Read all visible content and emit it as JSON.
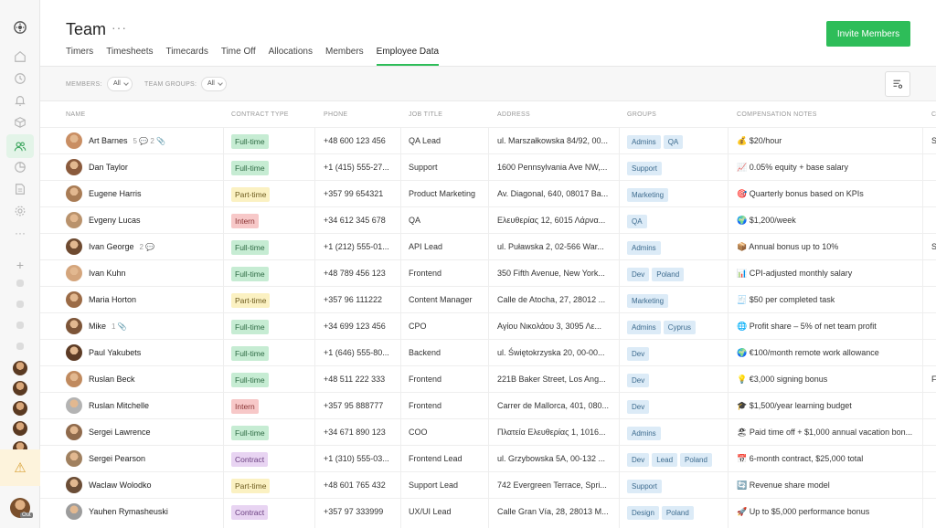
{
  "header": {
    "title": "Team",
    "more": "···",
    "invite_label": "Invite Members",
    "tabs": [
      "Timers",
      "Timesheets",
      "Timecards",
      "Time Off",
      "Allocations",
      "Members",
      "Employee Data"
    ],
    "active_tab": "Employee Data"
  },
  "filters": {
    "members_label": "MEMBERS:",
    "members_value": "All",
    "groups_label": "TEAM GROUPS:",
    "groups_value": "All"
  },
  "columns": [
    "NAME",
    "CONTRACT TYPE",
    "PHONE",
    "JOB TITLE",
    "ADDRESS",
    "GROUPS",
    "COMPENSATION NOTES",
    "C"
  ],
  "colors": {
    "accent": "#2ebd59",
    "full_time": "#c6ecd3",
    "part_time": "#fbf1c2",
    "intern": "#f7c8c8",
    "contract": "#e8d4f2",
    "group_badge": "#dcebf7"
  },
  "rows": [
    {
      "name": "Art Barnes",
      "meta": "5 💬  2 📎",
      "contract": "Full-time",
      "phone": "+48 600 123 456",
      "job": "QA Lead",
      "address": "ul. Marszałkowska 84/92, 00...",
      "groups": [
        "Admins",
        "QA"
      ],
      "comp": "💰 $20/hour",
      "extra": "S"
    },
    {
      "name": "Dan Taylor",
      "meta": "",
      "contract": "Full-time",
      "phone": "+1 (415) 555-27...",
      "job": "Support",
      "address": "1600 Pennsylvania Ave NW,...",
      "groups": [
        "Support"
      ],
      "comp": "📈 0.05% equity + base salary",
      "extra": ""
    },
    {
      "name": "Eugene Harris",
      "meta": "",
      "contract": "Part-time",
      "phone": "+357 99 654321",
      "job": "Product Marketing",
      "address": "Av. Diagonal, 640, 08017 Ba...",
      "groups": [
        "Marketing"
      ],
      "comp": "🎯 Quarterly bonus based on KPIs",
      "extra": ""
    },
    {
      "name": "Evgeny Lucas",
      "meta": "",
      "contract": "Intern",
      "phone": "+34 612 345 678",
      "job": "QA",
      "address": "Ελευθερίας 12, 6015 Λάρνα...",
      "groups": [
        "QA"
      ],
      "comp": "🌍 $1,200/week",
      "extra": ""
    },
    {
      "name": "Ivan George",
      "meta": "2 💬",
      "contract": "Full-time",
      "phone": "+1 (212) 555-01...",
      "job": "API Lead",
      "address": "ul. Puławska 2, 02-566 War...",
      "groups": [
        "Admins"
      ],
      "comp": "📦 Annual bonus up to 10%",
      "extra": "S"
    },
    {
      "name": "Ivan Kuhn",
      "meta": "",
      "contract": "Full-time",
      "phone": "+48 789 456 123",
      "job": "Frontend",
      "address": "350 Fifth Avenue, New York...",
      "groups": [
        "Dev",
        "Poland"
      ],
      "comp": "📊 CPI-adjusted monthly salary",
      "extra": ""
    },
    {
      "name": "Maria Horton",
      "meta": "",
      "contract": "Part-time",
      "phone": "+357 96 111222",
      "job": "Content Manager",
      "address": "Calle de Atocha, 27, 28012 ...",
      "groups": [
        "Marketing"
      ],
      "comp": "🧾 $50 per completed task",
      "extra": ""
    },
    {
      "name": "Mike",
      "meta": "1 📎",
      "contract": "Full-time",
      "phone": "+34 699 123 456",
      "job": "CPO",
      "address": "Αγίου Νικολάου 3, 3095 Λε...",
      "groups": [
        "Admins",
        "Cyprus"
      ],
      "comp": "🌐 Profit share – 5% of net team profit",
      "extra": ""
    },
    {
      "name": "Paul Yakubets",
      "meta": "",
      "contract": "Full-time",
      "phone": "+1 (646) 555-80...",
      "job": "Backend",
      "address": "ul. Świętokrzyska 20, 00-00...",
      "groups": [
        "Dev"
      ],
      "comp": "🌍 €100/month remote work allowance",
      "extra": ""
    },
    {
      "name": "Ruslan Beck",
      "meta": "",
      "contract": "Full-time",
      "phone": "+48 511 222 333",
      "job": "Frontend",
      "address": "221B Baker Street, Los Ang...",
      "groups": [
        "Dev"
      ],
      "comp": "💡 €3,000 signing bonus",
      "extra": "F"
    },
    {
      "name": "Ruslan Mitchelle",
      "meta": "",
      "contract": "Intern",
      "phone": "+357 95 888777",
      "job": "Frontend",
      "address": "Carrer de Mallorca, 401, 080...",
      "groups": [
        "Dev"
      ],
      "comp": "🎓 $1,500/year learning budget",
      "extra": ""
    },
    {
      "name": "Sergei Lawrence",
      "meta": "",
      "contract": "Full-time",
      "phone": "+34 671 890 123",
      "job": "COO",
      "address": "Πλατεία Ελευθερίας 1, 1016...",
      "groups": [
        "Admins"
      ],
      "comp": "🏖 Paid time off + $1,000 annual vacation bon...",
      "extra": ""
    },
    {
      "name": "Sergei Pearson",
      "meta": "",
      "contract": "Contract",
      "phone": "+1 (310) 555-03...",
      "job": "Frontend Lead",
      "address": "ul. Grzybowska 5A, 00-132 ...",
      "groups": [
        "Dev",
        "Lead",
        "Poland"
      ],
      "comp": "📅 6-month contract, $25,000 total",
      "extra": ""
    },
    {
      "name": "Waclaw Wolodko",
      "meta": "",
      "contract": "Part-time",
      "phone": "+48 601 765 432",
      "job": "Support Lead",
      "address": "742 Evergreen Terrace, Spri...",
      "groups": [
        "Support"
      ],
      "comp": "🔄 Revenue share model",
      "extra": ""
    },
    {
      "name": "Yauhen Rymasheuski",
      "meta": "",
      "contract": "Contract",
      "phone": "+357 97 333999",
      "job": "UX/UI Lead",
      "address": "Calle Gran Vía, 28, 28013 M...",
      "groups": [
        "Design",
        "Poland"
      ],
      "comp": "🚀 Up to $5,000 performance bonus",
      "extra": ""
    }
  ]
}
